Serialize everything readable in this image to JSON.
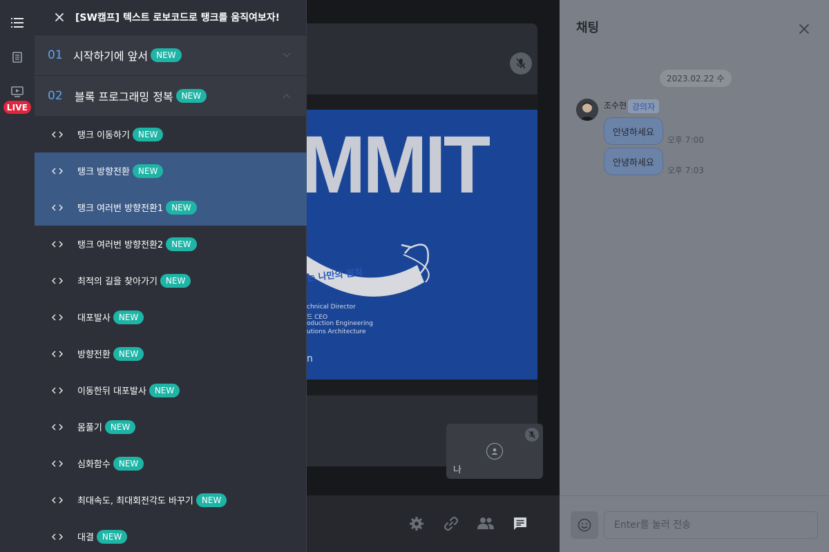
{
  "panel": {
    "title": "[SW캠프] 텍스트 로보코드로 탱크를 움직여보자!",
    "sections": [
      {
        "num": "01",
        "label": "시작하기에 앞서",
        "badge": "NEW"
      },
      {
        "num": "02",
        "label": "블록 프로그래밍 정복",
        "badge": "NEW"
      }
    ],
    "lessons": [
      {
        "label": "탱크 이동하기",
        "badge": "NEW"
      },
      {
        "label": "탱크 방향전환",
        "badge": "NEW"
      },
      {
        "label": "탱크 여러번 방향전환1",
        "badge": "NEW"
      },
      {
        "label": "탱크 여러번 방향전환2",
        "badge": "NEW"
      },
      {
        "label": "최적의 길을 찾아가기",
        "badge": "NEW"
      },
      {
        "label": "대포발사",
        "badge": "NEW"
      },
      {
        "label": "방향전환",
        "badge": "NEW"
      },
      {
        "label": "이동한뒤 대포발사",
        "badge": "NEW"
      },
      {
        "label": "몸풀기",
        "badge": "NEW"
      },
      {
        "label": "심화함수",
        "badge": "NEW"
      },
      {
        "label": "최대속도, 최대회전각도 바꾸기",
        "badge": "NEW"
      },
      {
        "label": "대결",
        "badge": "NEW"
      }
    ]
  },
  "rail": {
    "live": "LIVE"
  },
  "slide": {
    "headline": "MMIT",
    "ribbon": "는 나만의 원칙",
    "lines": [
      "chnical Director",
      "드 CEO",
      "oduction Engineering",
      "utions Architecture"
    ],
    "footer": "n"
  },
  "self_tile": {
    "label": "나"
  },
  "chat": {
    "title": "채팅",
    "date": "2023.02.22 수",
    "author": "조수현",
    "role": "강의자",
    "messages": [
      {
        "text": "안녕하세요",
        "time": "오후 7:00"
      },
      {
        "text": "안녕하세요",
        "time": "오후 7:03"
      }
    ],
    "input_placeholder": "Enter를 눌러 전송"
  },
  "colors": {
    "accent_new": "#1fb5a6",
    "live": "#e0263c",
    "section_num": "#5ea6f0",
    "active_row": "#3c5a86"
  }
}
